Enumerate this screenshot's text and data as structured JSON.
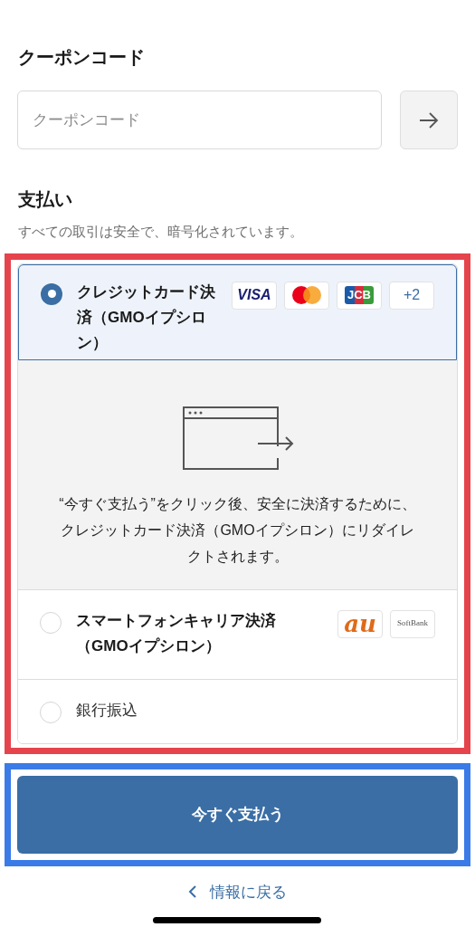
{
  "coupon": {
    "heading": "クーポンコード",
    "placeholder": "クーポンコード"
  },
  "payment": {
    "heading": "支払い",
    "subtitle": "すべての取引は安全で、暗号化されています。",
    "methods": [
      {
        "label": "クレジットカード決済（GMOイプシロン）",
        "selected": true,
        "badges": [
          {
            "kind": "visa",
            "text": "VISA"
          },
          {
            "kind": "mastercard"
          },
          {
            "kind": "jcb",
            "text": "JCB"
          },
          {
            "kind": "more",
            "text": "+2"
          }
        ],
        "note": "“今すぐ支払う”をクリック後、安全に決済するために、クレジットカード決済（GMOイプシロン）にリダイレクトされます。"
      },
      {
        "label": "スマートフォンキャリア決済（GMOイプシロン）",
        "selected": false,
        "badges": [
          {
            "kind": "au",
            "text": "au"
          },
          {
            "kind": "softbank",
            "text": "SoftBank"
          }
        ]
      },
      {
        "label": "銀行振込",
        "selected": false
      }
    ]
  },
  "pay_button": "今すぐ支払う",
  "back_link": "情報に戻る"
}
